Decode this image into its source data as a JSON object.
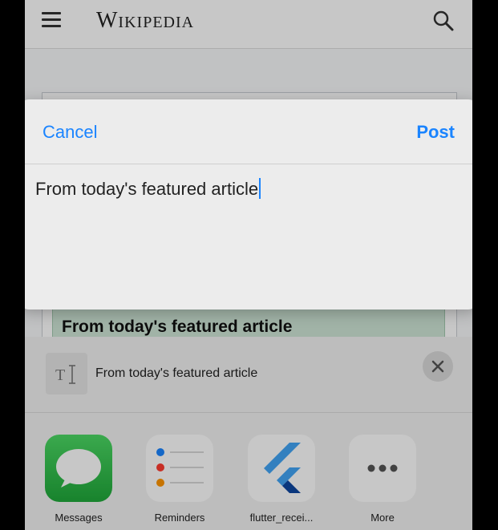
{
  "wiki": {
    "wordmark": "Wikipedia",
    "featured_heading": "From today's featured article"
  },
  "compose": {
    "cancel_label": "Cancel",
    "post_label": "Post",
    "text": "From today's featured article"
  },
  "share_preview": {
    "text": "From today's featured article"
  },
  "apps": [
    {
      "label": "Messages"
    },
    {
      "label": "Reminders"
    },
    {
      "label": "flutter_recei..."
    },
    {
      "label": "More"
    }
  ],
  "colors": {
    "accent": "#1a84ff",
    "messages_green": "#34c759",
    "flutter_blue": "#42a5f5"
  }
}
